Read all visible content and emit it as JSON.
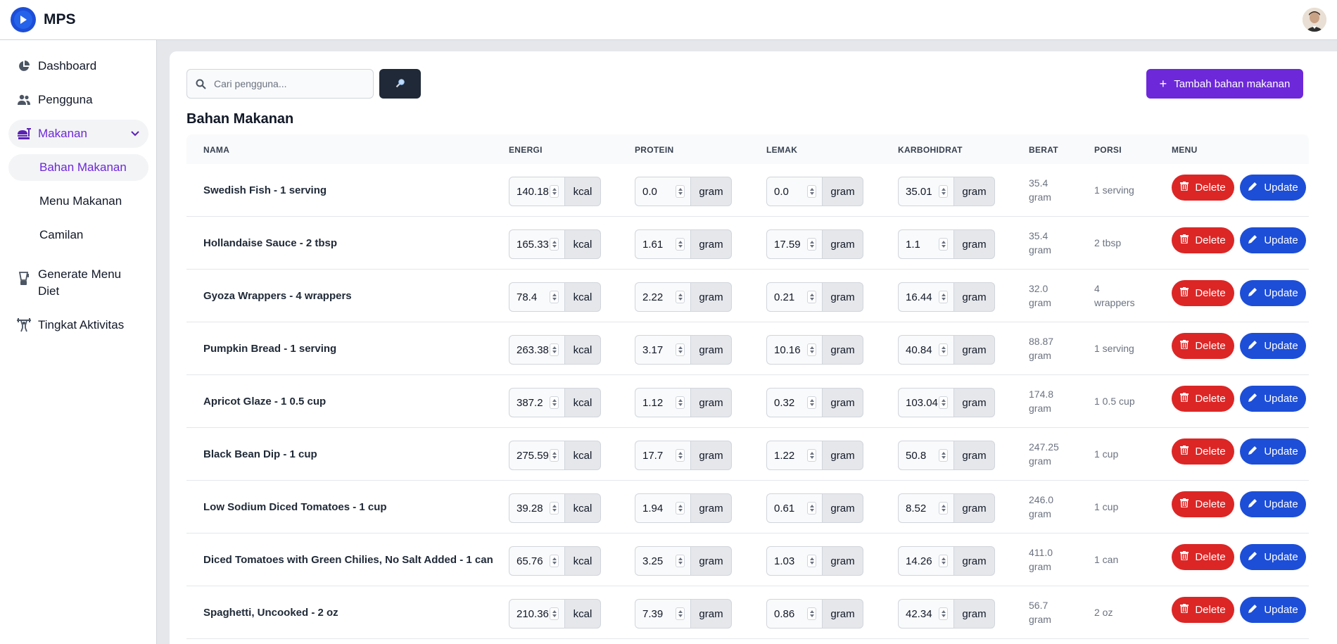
{
  "app": {
    "name": "MPS"
  },
  "sidebar": {
    "items": [
      {
        "label": "Dashboard",
        "icon": "pie-chart-icon"
      },
      {
        "label": "Pengguna",
        "icon": "users-icon"
      },
      {
        "label": "Makanan",
        "icon": "food-icon",
        "expanded": true,
        "children": [
          {
            "label": "Bahan Makanan",
            "active": true
          },
          {
            "label": "Menu Makanan"
          },
          {
            "label": "Camilan"
          }
        ]
      },
      {
        "label": "Generate Menu Diet",
        "icon": "blender-icon"
      },
      {
        "label": "Tingkat Aktivitas",
        "icon": "weightlifting-icon"
      }
    ]
  },
  "search": {
    "placeholder": "Cari pengguna..."
  },
  "toolbar": {
    "add_label": "Tambah bahan makanan"
  },
  "page": {
    "title": "Bahan Makanan"
  },
  "table": {
    "headers": [
      "NAMA",
      "ENERGI",
      "PROTEIN",
      "LEMAK",
      "KARBOHIDRAT",
      "BERAT",
      "PORSI",
      "MENU"
    ],
    "units": {
      "energy": "kcal",
      "nutrient": "gram"
    },
    "actions": {
      "delete": "Delete",
      "update": "Update"
    },
    "rows": [
      {
        "name": "Swedish Fish - 1 serving",
        "energi": "140.18",
        "protein": "0.0",
        "lemak": "0.0",
        "karbohidrat": "35.01",
        "berat": [
          "35.4",
          "gram"
        ],
        "porsi": [
          "1 serving"
        ]
      },
      {
        "name": "Hollandaise Sauce - 2 tbsp",
        "energi": "165.33",
        "protein": "1.61",
        "lemak": "17.59",
        "karbohidrat": "1.1",
        "berat": [
          "35.4",
          "gram"
        ],
        "porsi": [
          "2 tbsp"
        ]
      },
      {
        "name": "Gyoza Wrappers - 4 wrappers",
        "energi": "78.4",
        "protein": "2.22",
        "lemak": "0.21",
        "karbohidrat": "16.44",
        "berat": [
          "32.0",
          "gram"
        ],
        "porsi": [
          "4",
          "wrappers"
        ]
      },
      {
        "name": "Pumpkin Bread - 1 serving",
        "energi": "263.38",
        "protein": "3.17",
        "lemak": "10.16",
        "karbohidrat": "40.84",
        "berat": [
          "88.87",
          "gram"
        ],
        "porsi": [
          "1 serving"
        ]
      },
      {
        "name": "Apricot Glaze - 1 0.5 cup",
        "energi": "387.2",
        "protein": "1.12",
        "lemak": "0.32",
        "karbohidrat": "103.04",
        "berat": [
          "174.8",
          "gram"
        ],
        "porsi": [
          "1 0.5 cup"
        ]
      },
      {
        "name": "Black Bean Dip - 1 cup",
        "energi": "275.59",
        "protein": "17.7",
        "lemak": "1.22",
        "karbohidrat": "50.8",
        "berat": [
          "247.25",
          "gram"
        ],
        "porsi": [
          "1 cup"
        ]
      },
      {
        "name": "Low Sodium Diced Tomatoes - 1 cup",
        "energi": "39.28",
        "protein": "1.94",
        "lemak": "0.61",
        "karbohidrat": "8.52",
        "berat": [
          "246.0",
          "gram"
        ],
        "porsi": [
          "1 cup"
        ]
      },
      {
        "name": "Diced Tomatoes with Green Chilies, No Salt Added - 1 can",
        "energi": "65.76",
        "protein": "3.25",
        "lemak": "1.03",
        "karbohidrat": "14.26",
        "berat": [
          "411.0",
          "gram"
        ],
        "porsi": [
          "1 can"
        ]
      },
      {
        "name": "Spaghetti, Uncooked - 2 oz",
        "energi": "210.36",
        "protein": "7.39",
        "lemak": "0.86",
        "karbohidrat": "42.34",
        "berat": [
          "56.7",
          "gram"
        ],
        "porsi": [
          "2 oz"
        ]
      }
    ]
  }
}
